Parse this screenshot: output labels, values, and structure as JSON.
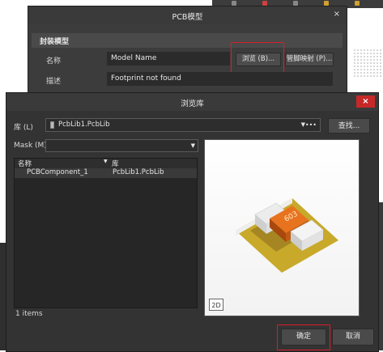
{
  "pcb_dialog": {
    "title": "PCB模型",
    "close": "×",
    "section": "封装模型",
    "name_label": "名称",
    "name_value": "Model Name",
    "browse_label": "浏览 (B)...",
    "pin_map_label": "管脚映射 (P)...",
    "desc_label": "描述",
    "desc_value": "Footprint not found"
  },
  "browse_dialog": {
    "title": "浏览库",
    "close": "×",
    "lib_label": "库 (L)",
    "lib_value": "PcbLib1.PcbLib",
    "lib_icon": "pcb-file-icon",
    "find_label": "查找...",
    "mask_label": "Mask (M)",
    "columns": {
      "name": "名称",
      "lib": "库"
    },
    "rows": [
      {
        "name": "PCBComponent_1",
        "lib": "PcbLib1.PcbLib"
      }
    ],
    "count": "1 items",
    "view_mode": "2D",
    "component_mark": "603"
  },
  "footer": {
    "ok": "确定",
    "cancel": "取消"
  },
  "colors": {
    "highlight": "#d91e2a",
    "close_red": "#c62828",
    "body_orange": "#e8731f",
    "pad_olive": "#c8a92a"
  }
}
